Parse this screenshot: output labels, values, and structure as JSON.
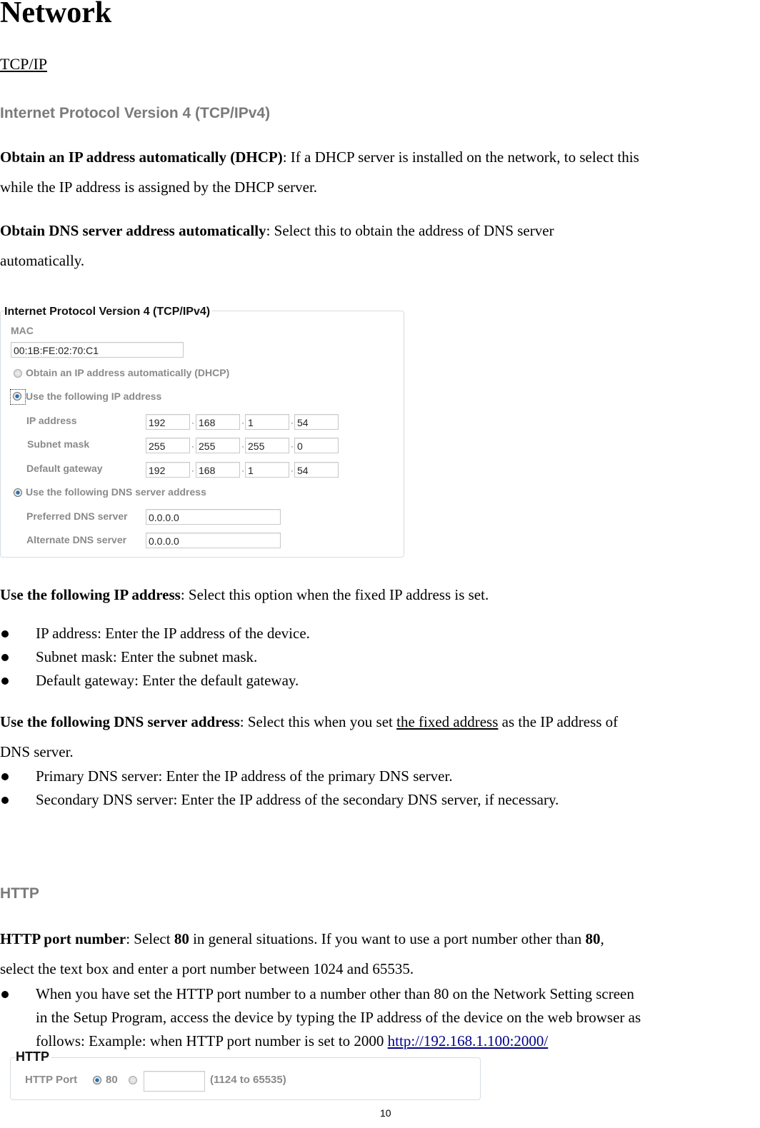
{
  "title": "Network",
  "subtitle": "TCP/IP",
  "section_ipv4_heading": "Internet Protocol Version 4 (TCP/IPv4)",
  "para_dhcp": {
    "bold": "Obtain an IP address automatically (DHCP)",
    "text1": ": If a DHCP server is installed on the network, to select this",
    "text2": "while the IP address is assigned by the DHCP server."
  },
  "para_dns_auto": {
    "bold": "Obtain DNS server address automatically",
    "text1": ": Select this to obtain the address of DNS server",
    "text2": "automatically."
  },
  "ipv4_panel": {
    "legend": "Internet Protocol Version 4 (TCP/IPv4)",
    "mac_label": "MAC",
    "mac_value": "00:1B:FE:02:70:C1",
    "dhcp_option": "Obtain an IP address automatically (DHCP)",
    "static_option": "Use the following IP address",
    "ip_label": "IP address",
    "ip": [
      "192",
      "168",
      "1",
      "54"
    ],
    "subnet_label": "Subnet mask",
    "subnet": [
      "255",
      "255",
      "255",
      "0"
    ],
    "gateway_label": "Default gateway",
    "gateway": [
      "192",
      "168",
      "1",
      "54"
    ],
    "dns_option": "Use the following DNS server address",
    "preferred_dns_label": "Preferred DNS server",
    "preferred_dns": "0.0.0.0",
    "alternate_dns_label": "Alternate DNS server",
    "alternate_dns": "0.0.0.0"
  },
  "para_static": {
    "bold": "Use the following IP address",
    "text": ": Select this option when the fixed IP address is set."
  },
  "static_bullets": [
    "IP address: Enter the IP address of the device.",
    "Subnet mask: Enter the subnet mask.",
    "Default gateway: Enter the default gateway."
  ],
  "para_dns_static": {
    "bold": "Use the following DNS server address",
    "text1": ": Select this when you set ",
    "underlined": "the fixed address",
    "text2": " as the IP address of",
    "text3": "DNS server."
  },
  "dns_bullets": [
    "Primary DNS server: Enter the IP address of the primary DNS server.",
    "Secondary DNS server: Enter the IP address of the secondary DNS server, if necessary."
  ],
  "section_http_heading": "HTTP",
  "para_http": {
    "bold1": "HTTP port number",
    "text1": ": Select ",
    "bold2": "80",
    "text2": " in general situations. If you want to use a port number other than ",
    "bold3": "80",
    "text3": ",",
    "text4": "select the text box and enter a port number between 1024 and 65535."
  },
  "http_bullet": {
    "line1": "When you have set the HTTP port number to a number other than 80 on the Network Setting screen",
    "line2": "in the Setup Program, access the device by typing the IP address of the device on the web browser as",
    "line3": "follows: Example: when HTTP port number is set to 2000 ",
    "link": "http://192.168.1.100:2000/"
  },
  "http_panel": {
    "legend": "HTTP",
    "port_label": "HTTP Port",
    "option_default": "80",
    "custom_value": "",
    "range_hint": "(1124 to 65535)"
  },
  "page_number": "10"
}
